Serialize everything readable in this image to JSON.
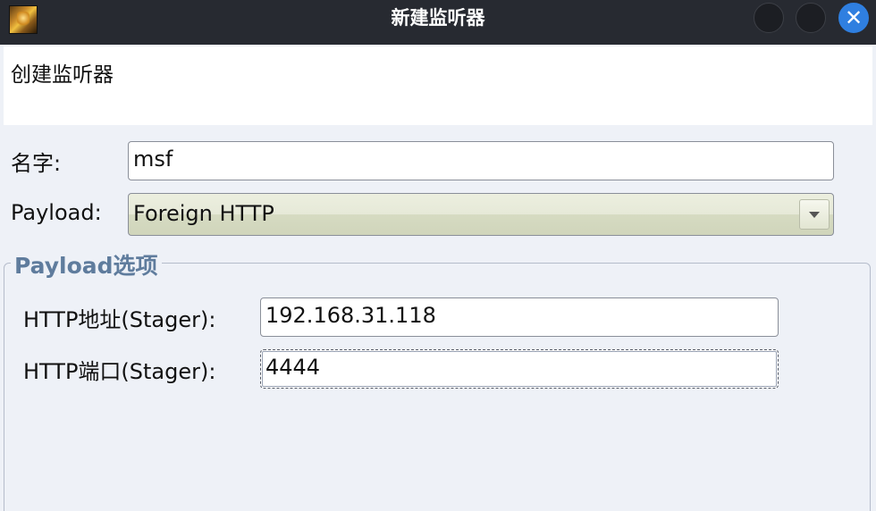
{
  "window": {
    "title": "新建监听器",
    "close_glyph": "✕",
    "icons": {
      "app": "app-icon",
      "minimize": "minimize-icon",
      "maximize": "maximize-icon",
      "close": "close-icon"
    }
  },
  "banner": {
    "text": "创建监听器"
  },
  "form": {
    "name_label": "名字:",
    "name_value": "msf",
    "payload_label": "Payload:",
    "payload_value": "Foreign HTTP"
  },
  "payload_options": {
    "title": "Payload选项",
    "host_label": "HTTP地址(Stager):",
    "host_value": "192.168.31.118",
    "port_label": "HTTP端口(Stager):",
    "port_value": "4444"
  },
  "colors": {
    "titlebar": "#272a31",
    "close_button": "#2f7fe0",
    "group_title": "#5f7c9d",
    "window_bg": "#eef1f7"
  }
}
